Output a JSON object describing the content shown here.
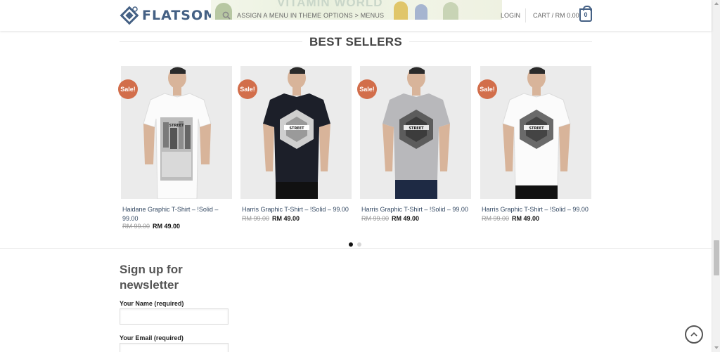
{
  "header": {
    "logo_text": "FLATSOME",
    "banner_text": "VITAMIN WORLD",
    "menu_notice": "ASSIGN A MENU IN THEME OPTIONS > MENUS",
    "login_label": "LOGIN",
    "cart_label": "CART / RM 0.00",
    "cart_count": "0"
  },
  "section": {
    "title": "BEST SELLERS"
  },
  "products": [
    {
      "badge": "Sale!",
      "title": "Haidane Graphic T-Shirt – !Solid – 99.00",
      "old_price": "RM 99.00",
      "price": "RM 49.00",
      "shirt_color": "white",
      "graphic": "city-print"
    },
    {
      "badge": "Sale!",
      "title": "Harris Graphic T-Shirt – !Solid – 99.00",
      "old_price": "RM 99.00",
      "price": "RM 49.00",
      "shirt_color": "black",
      "graphic": "hexagon"
    },
    {
      "badge": "Sale!",
      "title": "Harris Graphic T-Shirt – !Solid – 99.00",
      "old_price": "RM 99.00",
      "price": "RM 49.00",
      "shirt_color": "grey",
      "graphic": "hexagon"
    },
    {
      "badge": "Sale!",
      "title": "Harris Graphic T-Shirt – !Solid – 99.00",
      "old_price": "RM 99.00",
      "price": "RM 49.00",
      "shirt_color": "white",
      "graphic": "hexagon"
    }
  ],
  "slider": {
    "pages": 2,
    "active_page": 1
  },
  "newsletter": {
    "title": "Sign up for newsletter",
    "name_label": "Your Name (required)",
    "email_label": "Your Email (required)"
  },
  "colors": {
    "brand": "#446084",
    "sale_badge": "#d26e4b",
    "link": "#334862"
  },
  "icons": {
    "search": "search-icon",
    "cart": "cart-icon",
    "back_to_top": "chevron-up-icon"
  }
}
